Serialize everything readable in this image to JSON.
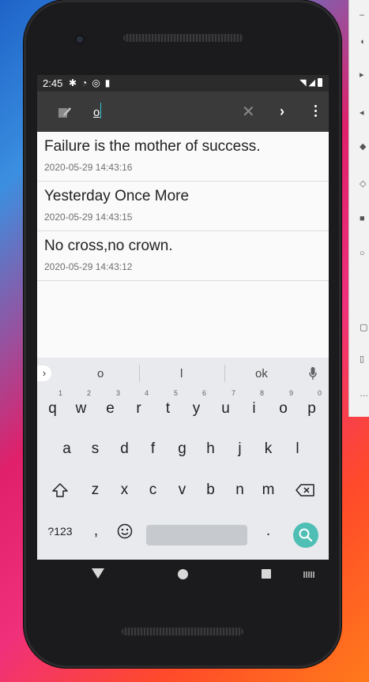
{
  "status_bar": {
    "time": "2:45"
  },
  "search": {
    "query": "o",
    "placeholder": ""
  },
  "notes": [
    {
      "title": "Failure is the mother of success.",
      "time": "2020-05-29 14:43:16"
    },
    {
      "title": "Yesterday Once More",
      "time": "2020-05-29 14:43:15"
    },
    {
      "title": "No cross,no crown.",
      "time": "2020-05-29 14:43:12"
    }
  ],
  "keyboard": {
    "suggestions": [
      "o",
      "l",
      "ok"
    ],
    "row1": [
      "q",
      "w",
      "e",
      "r",
      "t",
      "y",
      "u",
      "i",
      "o",
      "p"
    ],
    "row1_digits": [
      "1",
      "2",
      "3",
      "4",
      "5",
      "6",
      "7",
      "8",
      "9",
      "0"
    ],
    "row2": [
      "a",
      "s",
      "d",
      "f",
      "g",
      "h",
      "j",
      "k",
      "l"
    ],
    "row3": [
      "z",
      "x",
      "c",
      "v",
      "b",
      "n",
      "m"
    ],
    "symbols_label": "?123",
    "comma": ",",
    "period": "."
  },
  "colors": {
    "accent": "#4fbfb5",
    "toolbar": "#3a3a3a",
    "cursor": "#2ec4d4"
  }
}
